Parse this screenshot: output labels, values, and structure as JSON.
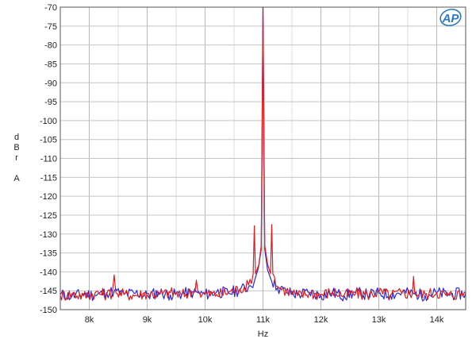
{
  "chart_data": {
    "type": "line",
    "title": "",
    "xlabel": "Hz",
    "ylabel_lines": [
      "d",
      "B",
      "r",
      "",
      "A"
    ],
    "xlim": [
      7500,
      14500
    ],
    "ylim": [
      -150,
      -70
    ],
    "x_ticks": [
      {
        "value": 8000,
        "label": "8k"
      },
      {
        "value": 9000,
        "label": "9k"
      },
      {
        "value": 10000,
        "label": "10k"
      },
      {
        "value": 11000,
        "label": "11k"
      },
      {
        "value": 12000,
        "label": "12k"
      },
      {
        "value": 13000,
        "label": "13k"
      },
      {
        "value": 14000,
        "label": "14k"
      }
    ],
    "y_ticks": [
      -70,
      -75,
      -80,
      -85,
      -90,
      -95,
      -100,
      -105,
      -110,
      -115,
      -120,
      -125,
      -130,
      -135,
      -140,
      -145,
      -150
    ],
    "y_tick_labels": [
      "-70",
      "-75",
      "-80",
      "-85",
      "-90",
      "-95",
      "-100",
      "-105",
      "-110",
      "-115",
      "-120",
      "-125",
      "-130",
      "-135",
      "-140",
      "-145",
      "-150"
    ],
    "grid": true,
    "legend": "none",
    "logo_text": "AP",
    "series": [
      {
        "color": "#2a2ad6",
        "points": [
          [
            7500,
            -146
          ],
          [
            7700,
            -146.5
          ],
          [
            7900,
            -145.8
          ],
          [
            8100,
            -146.2
          ],
          [
            8300,
            -145.5
          ],
          [
            8430,
            -145.2
          ],
          [
            8600,
            -146
          ],
          [
            8800,
            -145.6
          ],
          [
            9000,
            -146.3
          ],
          [
            9200,
            -145.4
          ],
          [
            9400,
            -146.1
          ],
          [
            9600,
            -145.8
          ],
          [
            9800,
            -145.5
          ],
          [
            10000,
            -146
          ],
          [
            10200,
            -145.3
          ],
          [
            10400,
            -145.6
          ],
          [
            10600,
            -144.8
          ],
          [
            10750,
            -144
          ],
          [
            10850,
            -142.5
          ],
          [
            10920,
            -139
          ],
          [
            10970,
            -134
          ],
          [
            11000,
            -70
          ],
          [
            11030,
            -134
          ],
          [
            11080,
            -139.5
          ],
          [
            11150,
            -142.5
          ],
          [
            11250,
            -144.2
          ],
          [
            11400,
            -145.3
          ],
          [
            11600,
            -146
          ],
          [
            11800,
            -145.4
          ],
          [
            12000,
            -146.2
          ],
          [
            12200,
            -145.6
          ],
          [
            12400,
            -146.3
          ],
          [
            12600,
            -145.5
          ],
          [
            12800,
            -146
          ],
          [
            13000,
            -145.7
          ],
          [
            13200,
            -146.1
          ],
          [
            13400,
            -145.4
          ],
          [
            13600,
            -145.8
          ],
          [
            13800,
            -146.2
          ],
          [
            14000,
            -145.5
          ],
          [
            14200,
            -146
          ],
          [
            14500,
            -145.7
          ]
        ]
      },
      {
        "color": "#e01b1b",
        "points": [
          [
            7500,
            -146.3
          ],
          [
            7700,
            -145.8
          ],
          [
            7900,
            -146.4
          ],
          [
            8100,
            -145.6
          ],
          [
            8300,
            -146
          ],
          [
            8400,
            -145.5
          ],
          [
            8430,
            -140.8
          ],
          [
            8460,
            -145.6
          ],
          [
            8600,
            -145.9
          ],
          [
            8800,
            -146.2
          ],
          [
            9000,
            -145.7
          ],
          [
            9200,
            -146
          ],
          [
            9400,
            -145.5
          ],
          [
            9600,
            -146.1
          ],
          [
            9800,
            -145.4
          ],
          [
            9850,
            -142.2
          ],
          [
            9880,
            -145.6
          ],
          [
            10000,
            -145.8
          ],
          [
            10200,
            -146
          ],
          [
            10400,
            -145.4
          ],
          [
            10600,
            -144.5
          ],
          [
            10750,
            -143.5
          ],
          [
            10830,
            -140.5
          ],
          [
            10850,
            -127.8
          ],
          [
            10870,
            -140.5
          ],
          [
            10930,
            -138
          ],
          [
            10970,
            -133
          ],
          [
            11000,
            -70
          ],
          [
            11030,
            -133
          ],
          [
            11080,
            -138
          ],
          [
            11130,
            -140.5
          ],
          [
            11150,
            -127.5
          ],
          [
            11170,
            -140.5
          ],
          [
            11250,
            -143.8
          ],
          [
            11400,
            -145
          ],
          [
            11600,
            -146.3
          ],
          [
            11800,
            -145.6
          ],
          [
            12000,
            -146
          ],
          [
            12200,
            -145.3
          ],
          [
            12400,
            -146.2
          ],
          [
            12600,
            -145.7
          ],
          [
            12800,
            -146
          ],
          [
            13000,
            -145.4
          ],
          [
            13200,
            -146.1
          ],
          [
            13400,
            -145.6
          ],
          [
            13580,
            -145.8
          ],
          [
            13600,
            -141.2
          ],
          [
            13620,
            -145.7
          ],
          [
            13800,
            -146
          ],
          [
            14000,
            -145.5
          ],
          [
            14200,
            -146.2
          ],
          [
            14500,
            -145.6
          ]
        ]
      }
    ]
  }
}
